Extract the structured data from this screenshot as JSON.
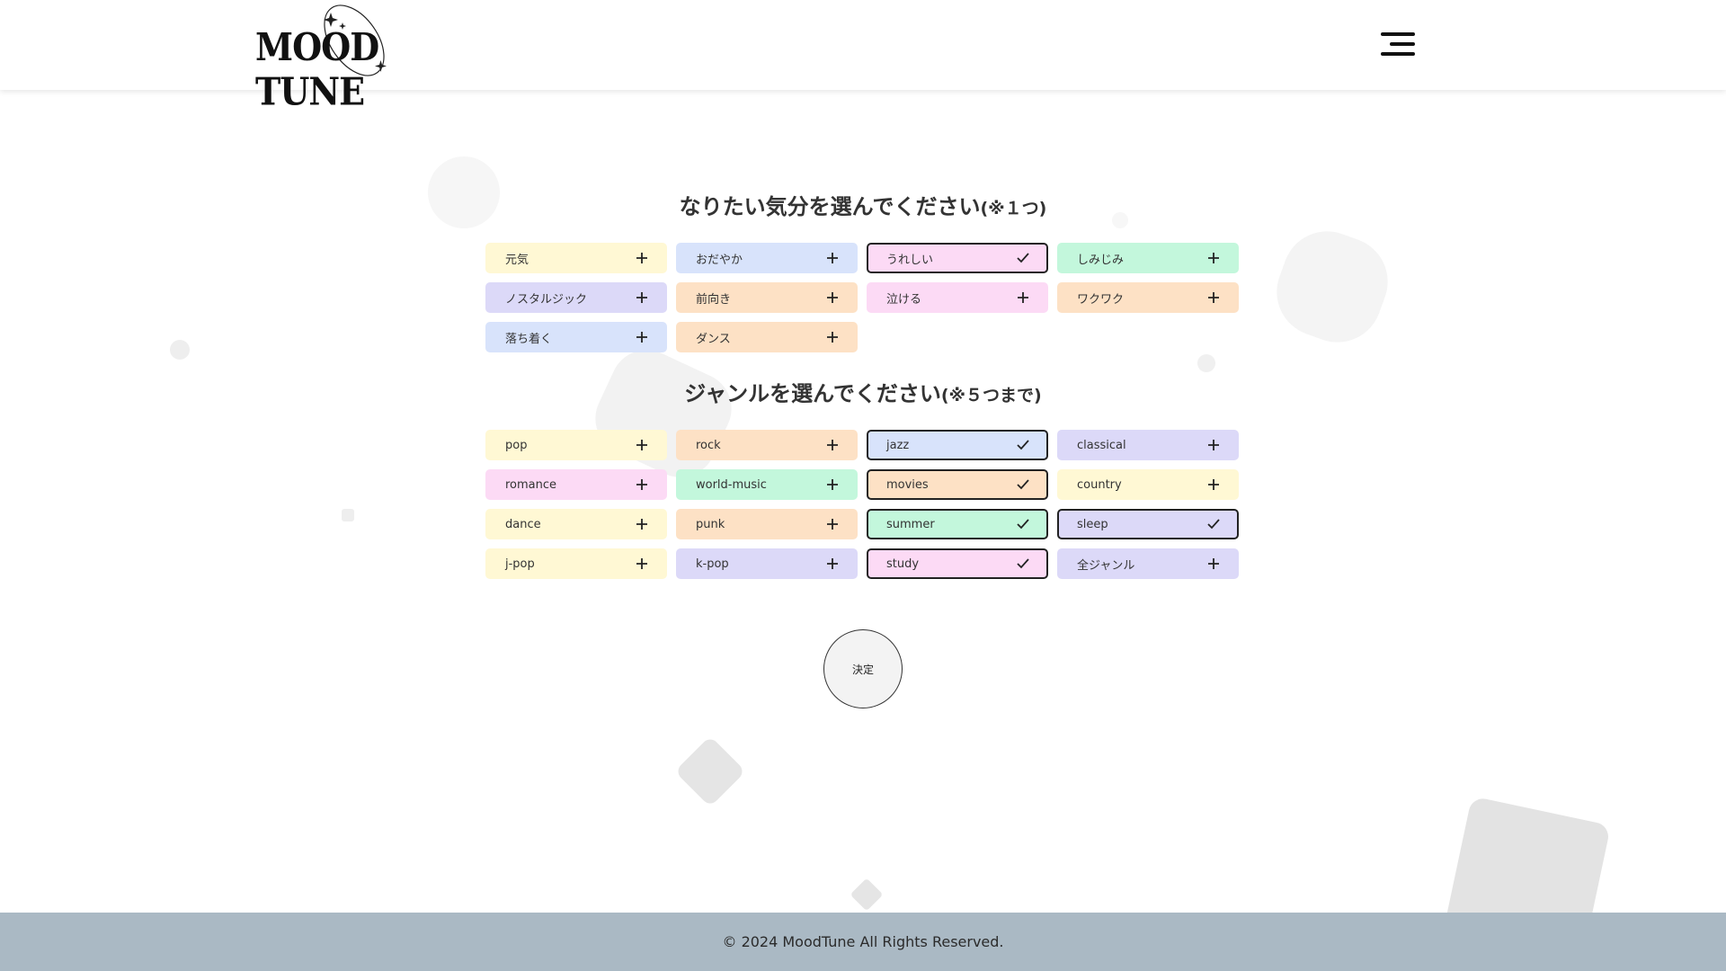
{
  "header": {
    "logo_text": "MOOD TUNE",
    "menu_icon": "hamburger-menu-icon"
  },
  "mood_section": {
    "title": "なりたい気分を選んでください",
    "note": "(※１つ)",
    "options": [
      {
        "label": "元気",
        "color": "#fff8d4",
        "selected": false
      },
      {
        "label": "おだやか",
        "color": "#d8e3fb",
        "selected": false
      },
      {
        "label": "うれしい",
        "color": "#fcdaf5",
        "selected": true
      },
      {
        "label": "しみじみ",
        "color": "#c3f7dc",
        "selected": false
      },
      {
        "label": "ノスタルジック",
        "color": "#dcd9f8",
        "selected": false
      },
      {
        "label": "前向き",
        "color": "#fde1c5",
        "selected": false
      },
      {
        "label": "泣ける",
        "color": "#fcdaf5",
        "selected": false
      },
      {
        "label": "ワクワク",
        "color": "#fde1c5",
        "selected": false
      },
      {
        "label": "落ち着く",
        "color": "#d8e3fb",
        "selected": false
      },
      {
        "label": "ダンス",
        "color": "#fde1c5",
        "selected": false
      }
    ]
  },
  "genre_section": {
    "title": "ジャンルを選んでください",
    "note": "(※５つまで)",
    "options": [
      {
        "label": "pop",
        "color": "#fff8d4",
        "selected": false
      },
      {
        "label": "rock",
        "color": "#fde1c5",
        "selected": false
      },
      {
        "label": "jazz",
        "color": "#d8e3fb",
        "selected": true
      },
      {
        "label": "classical",
        "color": "#dcd9f8",
        "selected": false
      },
      {
        "label": "romance",
        "color": "#fcdaf5",
        "selected": false
      },
      {
        "label": "world-music",
        "color": "#c3f7dc",
        "selected": false
      },
      {
        "label": "movies",
        "color": "#fde1c5",
        "selected": true
      },
      {
        "label": "country",
        "color": "#fff8d4",
        "selected": false
      },
      {
        "label": "dance",
        "color": "#fff8d4",
        "selected": false
      },
      {
        "label": "punk",
        "color": "#fde1c5",
        "selected": false
      },
      {
        "label": "summer",
        "color": "#c3f7dc",
        "selected": true
      },
      {
        "label": "sleep",
        "color": "#dcd9f8",
        "selected": true
      },
      {
        "label": "j-pop",
        "color": "#fff8d4",
        "selected": false
      },
      {
        "label": "k-pop",
        "color": "#dcd9f8",
        "selected": false
      },
      {
        "label": "study",
        "color": "#fcdaf5",
        "selected": true
      },
      {
        "label": "全ジャンル",
        "color": "#dcd9f8",
        "selected": false
      }
    ]
  },
  "icons": {
    "unselected": "plus-icon",
    "selected": "check-icon"
  },
  "decide_button": {
    "label": "決定"
  },
  "footer": {
    "copyright": "© 2024 MoodTune All Rights Reserved."
  }
}
